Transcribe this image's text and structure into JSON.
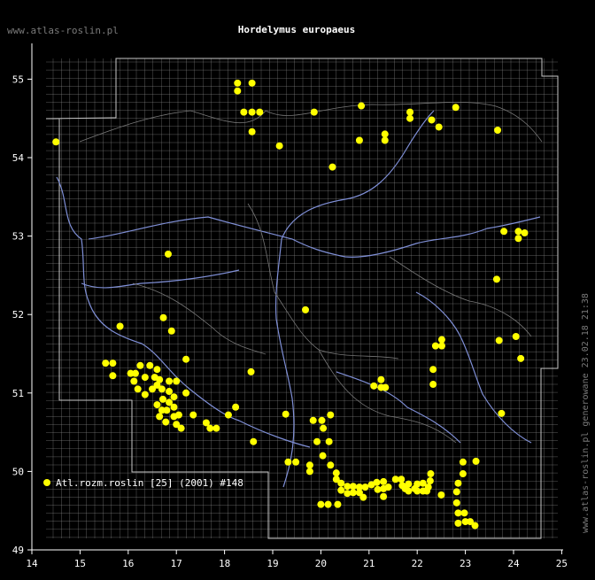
{
  "title": "Hordelymus europaeus",
  "site_label": "www.atlas-roslin.pl",
  "generated_label": "www.atlas-roslin.pl generowane 23.02.18 21:38",
  "legend_label": "Atl.rozm.roslin [25] (2001) #148",
  "colors": {
    "background": "#000000",
    "text": "#ffffff",
    "grid": "#8c8c8c",
    "border": "#c8c8c8",
    "rivers": "#7f8fd6",
    "points": "#ffff00"
  },
  "chart_data": {
    "type": "scatter",
    "x_ticks": [
      14,
      15,
      16,
      17,
      18,
      19,
      20,
      21,
      22,
      23,
      24,
      25
    ],
    "y_ticks": [
      49,
      50,
      51,
      52,
      53,
      54,
      55
    ],
    "xlim": [
      14,
      25
    ],
    "ylim": [
      49,
      55.6
    ],
    "series": [
      {
        "points": [
          [
            14.5,
            54.2
          ],
          [
            18.27,
            54.95
          ],
          [
            18.27,
            54.85
          ],
          [
            18.57,
            54.95
          ],
          [
            18.4,
            54.58
          ],
          [
            18.57,
            54.58
          ],
          [
            18.73,
            54.58
          ],
          [
            18.57,
            54.33
          ],
          [
            19.14,
            54.15
          ],
          [
            19.86,
            54.58
          ],
          [
            20.84,
            54.66
          ],
          [
            20.24,
            53.88
          ],
          [
            20.8,
            54.22
          ],
          [
            21.33,
            54.3
          ],
          [
            21.33,
            54.22
          ],
          [
            21.85,
            54.58
          ],
          [
            21.85,
            54.5
          ],
          [
            22.3,
            54.48
          ],
          [
            22.45,
            54.39
          ],
          [
            22.8,
            54.64
          ],
          [
            23.67,
            54.35
          ],
          [
            23.8,
            53.06
          ],
          [
            24.1,
            53.06
          ],
          [
            24.23,
            53.04
          ],
          [
            24.1,
            52.97
          ],
          [
            23.65,
            52.45
          ],
          [
            23.7,
            51.67
          ],
          [
            24.05,
            51.72
          ],
          [
            24.15,
            51.44
          ],
          [
            22.38,
            51.6
          ],
          [
            22.51,
            51.68
          ],
          [
            22.51,
            51.6
          ],
          [
            22.33,
            51.3
          ],
          [
            22.33,
            51.11
          ],
          [
            21.1,
            51.09
          ],
          [
            21.25,
            51.17
          ],
          [
            21.25,
            51.07
          ],
          [
            21.34,
            51.07
          ],
          [
            23.75,
            50.74
          ],
          [
            23.22,
            50.13
          ],
          [
            22.95,
            50.12
          ],
          [
            22.95,
            49.97
          ],
          [
            22.85,
            49.85
          ],
          [
            22.82,
            49.74
          ],
          [
            22.82,
            49.6
          ],
          [
            22.85,
            49.47
          ],
          [
            22.98,
            49.47
          ],
          [
            23.0,
            49.36
          ],
          [
            23.1,
            49.36
          ],
          [
            23.2,
            49.31
          ],
          [
            22.85,
            49.34
          ],
          [
            22.5,
            49.7
          ],
          [
            16.83,
            52.77
          ],
          [
            19.68,
            52.06
          ],
          [
            15.83,
            51.85
          ],
          [
            16.73,
            51.96
          ],
          [
            16.9,
            51.79
          ],
          [
            17.2,
            51.43
          ],
          [
            18.55,
            51.27
          ],
          [
            15.53,
            51.38
          ],
          [
            15.68,
            51.38
          ],
          [
            15.68,
            51.22
          ],
          [
            16.05,
            51.25
          ],
          [
            16.15,
            51.25
          ],
          [
            16.25,
            51.35
          ],
          [
            16.45,
            51.35
          ],
          [
            16.6,
            51.3
          ],
          [
            16.35,
            51.2
          ],
          [
            16.55,
            51.2
          ],
          [
            16.65,
            51.17
          ],
          [
            16.85,
            51.15
          ],
          [
            17.0,
            51.15
          ],
          [
            16.12,
            51.15
          ],
          [
            16.2,
            51.05
          ],
          [
            16.35,
            50.98
          ],
          [
            16.5,
            51.05
          ],
          [
            16.6,
            51.1
          ],
          [
            16.7,
            51.05
          ],
          [
            16.85,
            51.02
          ],
          [
            16.95,
            50.95
          ],
          [
            17.2,
            51.0
          ],
          [
            16.72,
            50.92
          ],
          [
            16.85,
            50.88
          ],
          [
            16.6,
            50.85
          ],
          [
            16.7,
            50.78
          ],
          [
            16.8,
            50.78
          ],
          [
            16.95,
            50.82
          ],
          [
            16.65,
            50.7
          ],
          [
            16.95,
            50.7
          ],
          [
            17.05,
            50.72
          ],
          [
            16.78,
            50.63
          ],
          [
            17.0,
            50.6
          ],
          [
            17.1,
            50.55
          ],
          [
            17.35,
            50.72
          ],
          [
            17.62,
            50.62
          ],
          [
            17.7,
            50.55
          ],
          [
            17.83,
            50.55
          ],
          [
            18.08,
            50.72
          ],
          [
            18.23,
            50.82
          ],
          [
            18.6,
            50.38
          ],
          [
            19.27,
            50.73
          ],
          [
            19.84,
            50.65
          ],
          [
            20.02,
            50.65
          ],
          [
            20.2,
            50.72
          ],
          [
            20.05,
            50.55
          ],
          [
            19.92,
            50.38
          ],
          [
            20.17,
            50.38
          ],
          [
            20.04,
            50.2
          ],
          [
            19.32,
            50.12
          ],
          [
            19.48,
            50.12
          ],
          [
            19.77,
            50.08
          ],
          [
            19.77,
            50.0
          ],
          [
            20.2,
            50.08
          ],
          [
            20.32,
            49.98
          ],
          [
            20.32,
            49.9
          ],
          [
            20.42,
            49.85
          ],
          [
            20.42,
            49.76
          ],
          [
            20.55,
            49.81
          ],
          [
            20.55,
            49.72
          ],
          [
            20.67,
            49.81
          ],
          [
            20.67,
            49.73
          ],
          [
            20.8,
            49.8
          ],
          [
            20.8,
            49.73
          ],
          [
            20.88,
            49.67
          ],
          [
            20.92,
            49.8
          ],
          [
            21.05,
            49.83
          ],
          [
            21.16,
            49.86
          ],
          [
            21.18,
            49.77
          ],
          [
            21.3,
            49.87
          ],
          [
            21.3,
            49.78
          ],
          [
            21.4,
            49.8
          ],
          [
            21.3,
            49.68
          ],
          [
            21.55,
            49.9
          ],
          [
            21.67,
            49.9
          ],
          [
            21.69,
            49.82
          ],
          [
            21.75,
            49.78
          ],
          [
            21.82,
            49.84
          ],
          [
            21.82,
            49.75
          ],
          [
            21.95,
            49.78
          ],
          [
            22.0,
            49.84
          ],
          [
            22.0,
            49.75
          ],
          [
            22.12,
            49.75
          ],
          [
            22.12,
            49.85
          ],
          [
            22.23,
            49.8
          ],
          [
            22.28,
            49.97
          ],
          [
            22.27,
            49.88
          ],
          [
            22.2,
            49.75
          ],
          [
            20.35,
            49.58
          ],
          [
            20.15,
            49.58
          ],
          [
            20.0,
            49.58
          ]
        ]
      }
    ]
  }
}
